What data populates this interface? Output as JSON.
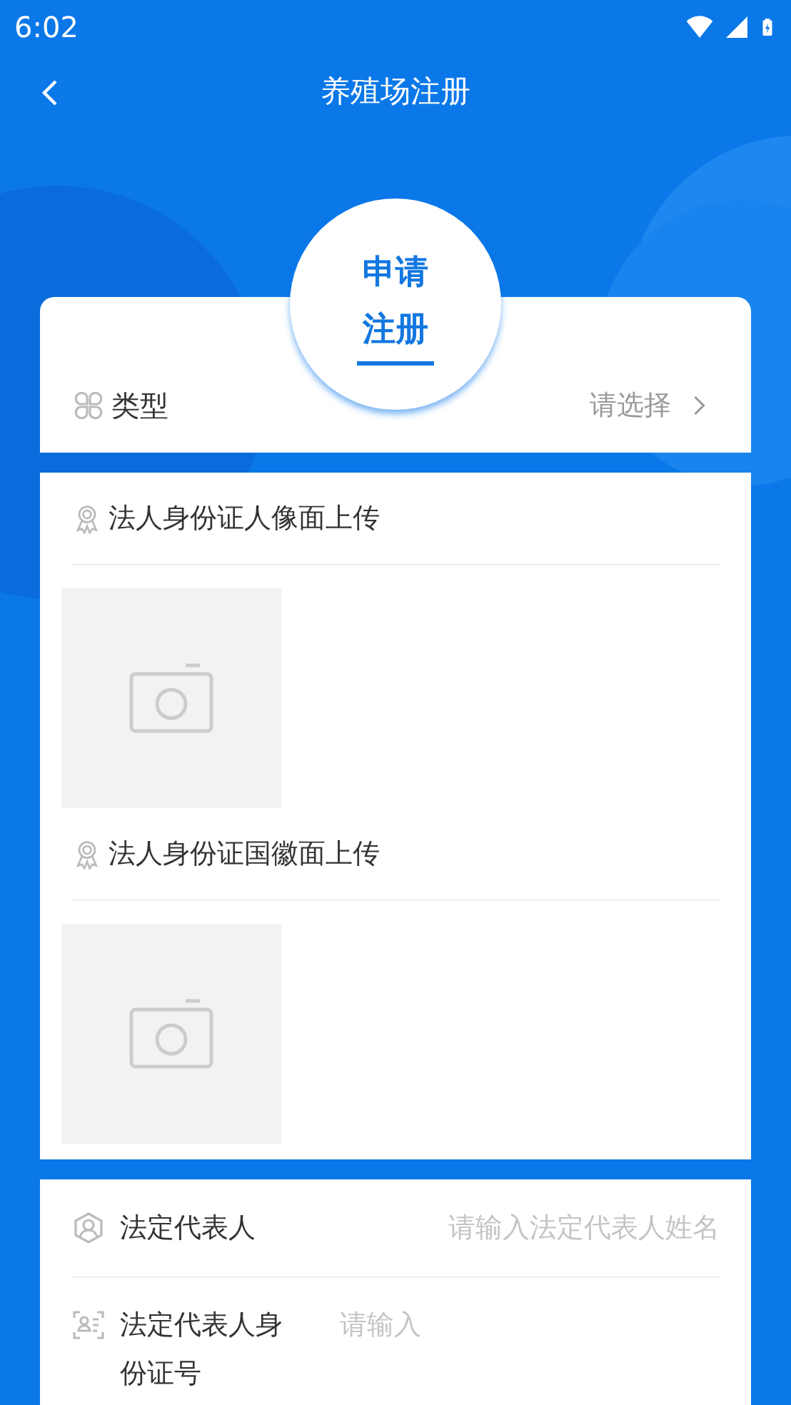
{
  "status_bar": {
    "time": "6:02"
  },
  "header": {
    "title": "养殖场注册"
  },
  "badge": {
    "lines": [
      "申请",
      "注册"
    ]
  },
  "type_row": {
    "label": "类型",
    "placeholder": "请选择"
  },
  "uploads": [
    {
      "label": "法人身份证人像面上传"
    },
    {
      "label": "法人身份证国徽面上传"
    }
  ],
  "fields": [
    {
      "kind": "person",
      "label": "法定代表人",
      "placeholder": "请输入法定代表人姓名"
    },
    {
      "kind": "id-card",
      "label": "法定代表人身份证号",
      "placeholder": "请输入"
    }
  ]
}
